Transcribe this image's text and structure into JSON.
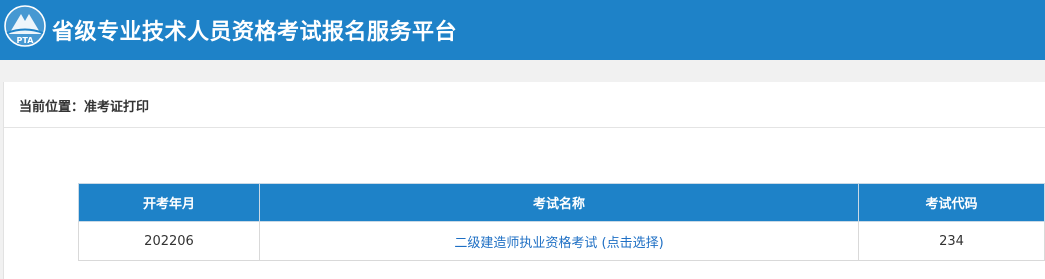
{
  "header": {
    "logo_text": "PTA",
    "title": "省级专业技术人员资格考试报名服务平台"
  },
  "breadcrumb": {
    "label": "当前位置：",
    "current": "准考证打印"
  },
  "table": {
    "columns": [
      "开考年月",
      "考试名称",
      "考试代码"
    ],
    "rows": [
      {
        "exam_month": "202206",
        "exam_name": "二级建造师执业资格考试 (点击选择)",
        "exam_code": "234"
      }
    ]
  },
  "colors": {
    "brand_blue": "#1e82c8",
    "link_blue": "#1e6fc4",
    "page_bg": "#f1f1f1"
  },
  "icons": {
    "logo": "pta-logo-icon"
  }
}
